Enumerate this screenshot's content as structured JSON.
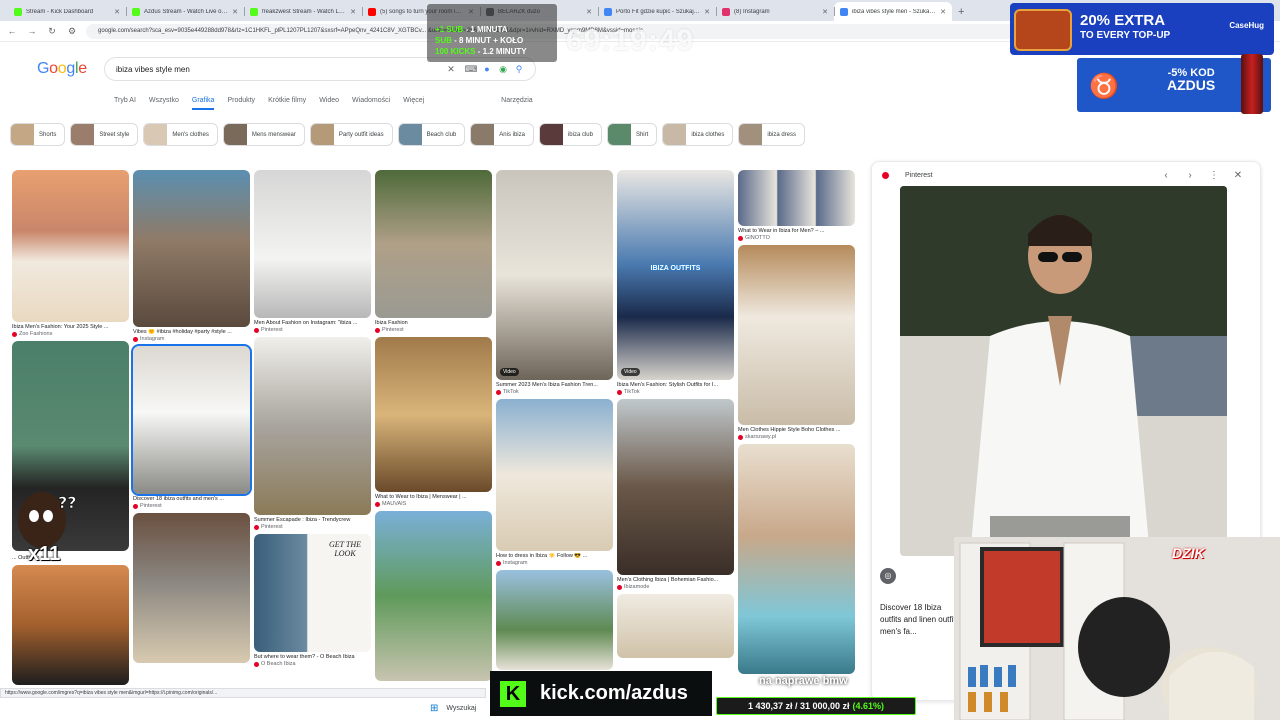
{
  "tabs": [
    {
      "label": "Stream - Kick Dashboard",
      "color": "#53fc18"
    },
    {
      "label": "Azdus Stream - Watch Live on Kick",
      "color": "#53fc18"
    },
    {
      "label": "freakzwest Stream - Watch Live on Kick",
      "color": "#53fc18"
    },
    {
      "label": "(5) songs to turn your room into...",
      "color": "#ff0000"
    },
    {
      "label": "BELARZK duzo",
      "color": "#5f6368"
    },
    {
      "label": "Porto Fit gdzie kupic - Szukaj w Google",
      "color": "#4285f4"
    },
    {
      "label": "(8) Instagram",
      "color": "#e1306c"
    },
    {
      "label": "ibiza vibes style men - Szukaj w Google",
      "color": "#4285f4",
      "active": true
    }
  ],
  "address": "google.com/search?sca_esv=9035e449288dd978&rlz=1C1HKFL_plPL1207PL1207&sxsrf=APpeQnv_4241C8V_XGTBCv... &udm=2&biw=2560&bih=1321&dpr=1#vhid=RXMD_yqsm9MD8M&vssid=mosaic",
  "google": {
    "logo": [
      "G",
      "o",
      "o",
      "g",
      "l",
      "e"
    ],
    "query": "ibiza vibes style men",
    "filters": [
      "Tryb AI",
      "Wszystko",
      "Grafika",
      "Produkty",
      "Krótkie filmy",
      "Wideo",
      "Wiadomości",
      "Więcej"
    ],
    "selected_filter": "Grafika",
    "tools": "Narzędzia"
  },
  "chips": [
    {
      "label": "Shorts",
      "color": "#c4a885"
    },
    {
      "label": "Street style",
      "color": "#9a7d6a"
    },
    {
      "label": "Men's clothes",
      "color": "#d9c8b4"
    },
    {
      "label": "Mens menswear",
      "color": "#7a6a5a"
    },
    {
      "label": "Party outfit ideas",
      "color": "#b59a7a"
    },
    {
      "label": "Beach club",
      "color": "#6a8ba0"
    },
    {
      "label": "Anis ibiza",
      "color": "#8a7a6a"
    },
    {
      "label": "ibiza club",
      "color": "#5a3a3a"
    },
    {
      "label": "Shirt",
      "color": "#5a8a6a"
    },
    {
      "label": "ibiza clothes",
      "color": "#c8b8a6"
    },
    {
      "label": "ibiza dress",
      "color": "#a0907c"
    }
  ],
  "columns": [
    [
      {
        "cap": "Ibiza Men's Fashion: Your 2025 Style ...",
        "src": "Zoo Fashions",
        "h": 152,
        "bg": "linear-gradient(180deg,#e8a070 0%,#c9866a 40%,#f1e9de 60%,#e9d9c0 100%)"
      },
      {
        "cap": "",
        "src": "",
        "h": 210,
        "bg": "linear-gradient(180deg,#4b7f6a 0%,#5a8a70 50%,#242424 70%,#3a3a3a 100%)"
      },
      {
        "cap": "... Outfit for a ...",
        "src": "",
        "h": 12,
        "bg": "transparent"
      },
      {
        "cap": "",
        "src": "",
        "h": 120,
        "bg": "linear-gradient(180deg,#d58a50 0%,#a3602e 50%,#1e1e1e 100%)"
      }
    ],
    [
      {
        "cap": "Vibes 🌞 #ibiza #holiday #party #style ...",
        "src": "Instagram",
        "h": 157,
        "bg": "linear-gradient(180deg,#5b8fb0 0%,#8f7a66 45%,#5a4a3e 100%)"
      },
      {
        "cap": "Discover 18 ibiza outfits and men's ...",
        "src": "Pinterest",
        "h": 148,
        "bg": "linear-gradient(180deg,#dcd8d2 0%,#f7f7f5 45%,#8a8a86 100%)",
        "sel": true
      },
      {
        "cap": "",
        "src": "",
        "h": 150,
        "bg": "linear-gradient(180deg,#6a5040 0%,#8a8680 45%,#d8cab0 100%)"
      }
    ],
    [
      {
        "cap": "Men About Fashion on Instagram: \"ibiza ...",
        "src": "Pinterest",
        "h": 148,
        "bg": "linear-gradient(180deg,#d6d6d6 0%,#f3f3f1 60%,#b8b8b8 100%)"
      },
      {
        "cap": "Summer Escapade : Ibiza - Trendycrew",
        "src": "Pinterest",
        "h": 178,
        "bg": "linear-gradient(180deg,#f0efea 0%,#a8a49e 50%,#8a7a58 100%)"
      },
      {
        "cap": "But where to wear them? - O Beach Ibiza",
        "src": "O Beach Ibiza",
        "h": 118,
        "bg": "linear-gradient(90deg,#3a5f7a 0%,#6a8aa0 45%,#f7f5f2 46%,#f7f5f2 100%)",
        "getlook": "GET THE LOOK"
      }
    ],
    [
      {
        "cap": "Ibiza Fashion",
        "src": "Pinterest",
        "h": 148,
        "bg": "linear-gradient(180deg,#4e6a3a 0%,#b0a088 50%,#9a9a92 100%)"
      },
      {
        "cap": "What to Wear to Ibiza | Menswear | ...",
        "src": "MAUVAIS",
        "h": 155,
        "bg": "linear-gradient(180deg,#a07a4a 0%,#d9b57a 50%,#6a4a2a 100%)"
      },
      {
        "cap": "",
        "src": "",
        "h": 170,
        "bg": "linear-gradient(180deg,#7ab0d8 0%,#5f9a5a 50%,#c8c4b0 100%)"
      }
    ],
    [
      {
        "cap": "Summer 2023 Men's Ibiza Fashion Tren...",
        "src": "TikTok",
        "h": 210,
        "bg": "linear-gradient(180deg,#c9c5bd 0%,#e9e4da 50%,#6e655a 100%)",
        "video": "Video"
      },
      {
        "cap": "How to dress in Ibiza ☀️ Follow 😎 ...",
        "src": "Instagram",
        "h": 152,
        "bg": "linear-gradient(180deg,#8ab0d0 0%,#efe8dc 50%,#d9cbb3 100%)"
      },
      {
        "cap": "",
        "src": "",
        "h": 100,
        "bg": "linear-gradient(180deg,#9ac0e0 0%,#5f8a52 60%,#e8e2d8 100%)"
      }
    ],
    [
      {
        "cap": "Ibiza Men's Fashion: Stylish Outfits for I...",
        "src": "TikTok",
        "h": 210,
        "bg": "linear-gradient(180deg,#e9e7e3 0%,#4a7ab0 45%,#1a2a4a 70%,#d8d4cd 100%)",
        "video": "Video",
        "overlay": "IBIZA OUTFITS"
      },
      {
        "cap": "Men's Clothing Ibiza | Bohemian Fashio...",
        "src": "Ibizamode",
        "h": 176,
        "bg": "linear-gradient(180deg,#c0c8cc 0%,#6a5848 50%,#3a2e28 100%)"
      },
      {
        "cap": "",
        "src": "",
        "h": 64,
        "bg": "linear-gradient(180deg,#f0ebe2 0%,#d0c2a8 100%)"
      }
    ],
    [
      {
        "cap": "What to Wear in Ibiza for Men? – ...",
        "src": "GINOTTO",
        "h": 56,
        "bg": "linear-gradient(90deg,#5a6a8a 0%,#e8e4dc 33%,#5a6a8a 34%,#e8e4dc 66%,#5a6a8a 67%,#e8e4dc 100%)"
      },
      {
        "cap": "Men Clothes Hippie Style Boho Clothes ...",
        "src": "skarszawy.pl",
        "h": 180,
        "bg": "linear-gradient(180deg,#b58a5a 0%,#efe9df 40%,#c9bca8 100%)"
      },
      {
        "cap": "",
        "src": "",
        "h": 230,
        "bg": "linear-gradient(180deg,#e9dfcf 0%,#c8a88a 40%,#7fc7d8 75%,#3a7a8a 100%)"
      }
    ]
  ],
  "panel": {
    "source": "Pinterest",
    "caption": "Discover 18 Ibiza outfits and linen outfit, men's fa...",
    "prev": "‹",
    "next": "›",
    "more": "⋮",
    "close": "✕"
  },
  "overlay": {
    "timer": "69:19:49",
    "goals": [
      "1 MINUTA",
      "8 MINUT + KOŁO",
      "1.2 MINUTY"
    ],
    "goal_prefixes": [
      "+1 SUB",
      "SUB",
      "100 KICKS"
    ],
    "promo1_main": "20% EXTRA",
    "promo1_sub": "TO EVERY TOP-UP",
    "promo1_brand": "CaseHug",
    "promo2_top": "-5% KOD",
    "promo2_code": "AZDUS",
    "kick_url": "kick.com/azdus",
    "goal_text": "1 430,37 zł / 31 000,00 zł",
    "goal_pct": "(4.61%)",
    "bottom_text": "na naprawe bmw",
    "dzik": "DZIK",
    "emote_mult": "x11"
  },
  "statusbar": "https://www.google.com/imgres?q=ibiza vibes style men&imgurl=https://i.pinimg.com/originals/...",
  "taskbar": {
    "search": "Wyszukaj"
  }
}
